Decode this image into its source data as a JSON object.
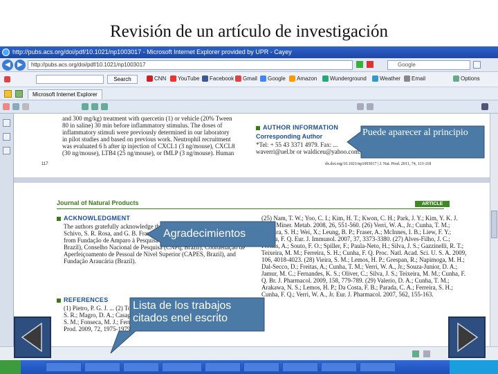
{
  "slide": {
    "title": "Revisión de un artículo de investigación"
  },
  "browser": {
    "window_title": "http://pubs.acs.org/doi/pdf/10.1021/np1003017 - Microsoft Internet Explorer provided by UPR - Cayey",
    "url": "http://pubs.acs.org/doi/pdf/10.1021/np1003017",
    "search_engine": "Google",
    "toolbar": {
      "search_button": "Search",
      "bookmarks": [
        "CNN",
        "YouTube",
        "Facebook",
        "Gmail",
        "Google",
        "Amazon",
        "Wunderground",
        "Weather",
        "Email"
      ],
      "right_item": "Options"
    },
    "tab_label": "Microsoft Internet Explorer"
  },
  "document": {
    "page_number": "117",
    "top_left_text": "and 300 mg/kg) treatment with quercetin (1) or vehicle (20% Tween 80 in saline) 30 min before inflammatory stimulus. The doses of inflammatory stimuli were previously determined in our laboratory in pilot studies and based on previous work. Neutrophil recruitment was evaluated 6 h after ip injection of CXCL1 (3 ng/mouse), CXCL8 (30 ng/mouse), LTB4 (25 ng/mouse), or fMLP (3 ng/mouse). Human",
    "author_info_heading": "AUTHOR INFORMATION",
    "corresponding_author": "Corresponding Author",
    "tel_line": "*Tel: + 55 43 3371 4979. Fax: ...",
    "email_line": "waverri@uel.br or waldiceu@yahoo.com.br.",
    "doi_footer": "dx.doi.org/10.1021/np1003017 | J. Nat. Prod. 2011, 74, 113-118",
    "journal_name": "Journal of Natural Products",
    "article_badge": "ARTICLE",
    "acknowledgment_heading": "ACKNOWLEDGMENT",
    "acknowledgment_text": "The authors gratefully acknowledge the technical assistance of I. R. S. Schivo, S. R. Rosa, and G. B. Francisco. This work was supported by grants from Fundação de Amparo à Pesquisa do Estado de São Paulo (FAPESP, Brazil), Conselho Nacional de Pesquisa (CNPq, Brazil), Coordenação de Aperfeiçoamento de Pessoal de Nível Superior (CAPES, Brazil), and Fundação Araucária (Brazil).",
    "references_heading": "REFERENCES",
    "references_text": "(1) Pietro, P. G. J. ... (2) Tormicz, J. V.; Bog... (3) Valerio, D. A.; Georgetti, S. R.; Magro, D. A.; Casagrande, R.; Cunha, T. M.; Vicentini, F. T.; Vieira, S. M.; Fonseca, M. J.; Ferreira, S. H.; Cunha, F. Q.; Verri, W. A., Jr. J. Nat. Prod. 2009, 72, 1975-1979.",
    "right_column_text": "(25) Nam, T. W.; Yoo, C. I.; Kim, H. T.; Kwon, C. H.; Park, J. Y.; Kim, Y. K. J. Bone Miner. Metab. 2008, 26, 551-560. (26) Verri, W. A., Jr.; Cunha, T. M.; Ferreira, S. H.; Wei, X.; Leung, B. P.; Fraser, A.; McInnes, I. B.; Liew, F. Y.; Cunha, F. Q. Eur. J. Immunol. 2007, 37, 3373-3380. (27) Alves-Filho, J. C.; Freitas, A.; Souto, F. O.; Spiller, F.; Paula-Neto, H.; Silva, J. S.; Gazzinelli, R. T.; Teixeira, M. M.; Ferreira, S. H.; Cunha, F. Q. Proc. Natl. Acad. Sci. U. S. A. 2009, 106, 4018-4023. (28) Vieira, S. M.; Lemos, H. P.; Grespan, R.; Napimoga, M. H.; Dal-Secco, D.; Freitas, A.; Cunha, T. M.; Verri, W. A., Jr.; Souza-Junior, D. A.; Jamur, M. C.; Fernandes, K. S.; Oliver, C.; Silva, J. S.; Teixeira, M. M.; Cunha, F. Q. Br. J. Pharmacol. 2009, 158, 779-789. (29) Valerio, D. A.; Cunha, T. M.; Arakawa, N. S.; Lemos, H. P.; Da Costa, F. B.; Parada, C. A.; Ferreira, S. H.; Cunha, F. Q.; Verri, W. A., Jr. Eur. J. Pharmacol. 2007, 562, 155-163."
  },
  "callouts": {
    "author_info": "Puede aparecer al principio",
    "acknowledgment": "Agradecimientos",
    "references": "Lista de los trabajos citados enel escrito"
  },
  "colors": {
    "callout_fill": "#4a7aa5",
    "arrow_dark": "#3a3a3a",
    "journal_green": "#3a7a1a",
    "section_blue": "#1a4d9a"
  }
}
